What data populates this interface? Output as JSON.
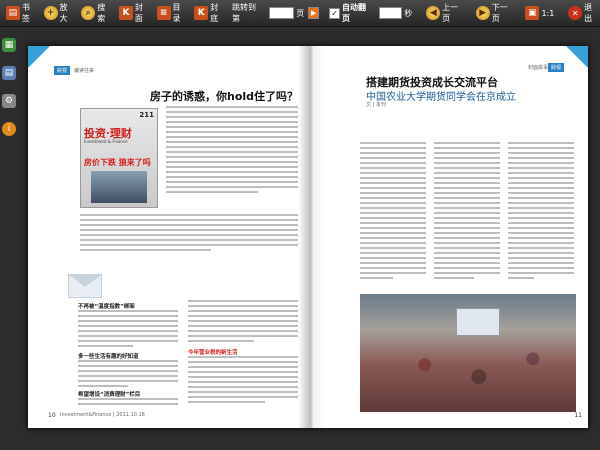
{
  "toolbar": {
    "bookmark_label": "书签",
    "zoom_in_label": "放大",
    "search_label": "搜索",
    "cover_label": "封面",
    "toc_label": "目录",
    "back_cover_label": "封底",
    "jump_label": "跳转到第",
    "page_unit": "页",
    "autoflip_label": "自动翻页",
    "seconds_unit": "秒",
    "prev_label": "上一页",
    "next_label": "下一页",
    "ratio_label": "1:1",
    "exit_label": "退出"
  },
  "left_page": {
    "section_tag": "财视",
    "section_label": "编读往来",
    "headline": "房子的诱惑，你hold住了吗？",
    "cover": {
      "title": "投资·理财",
      "subtitle": "Investment & Finance",
      "issue": "211",
      "cover_line": "房价下跌 狼来了吗"
    },
    "sub1": "不再被“温度指数”绑架",
    "sub2": "多一些生活有趣的好知道",
    "sub3": "希望增设“消费理财”栏目",
    "sub4": "今年营业税的新生活",
    "page_number": "10",
    "footer": "Investment&Finance | 2011.10.16"
  },
  "right_page": {
    "section_tag": "财视",
    "section_label": "封面故事",
    "title": "搭建期货投资成长交流平台",
    "subtitle": "中国农业大学期货同学会在京成立",
    "byline": "文 | 本刊",
    "page_number": "11"
  }
}
